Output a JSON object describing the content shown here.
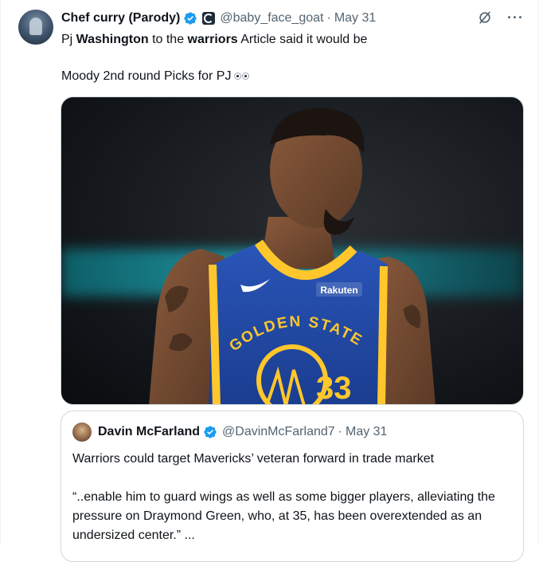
{
  "tweet": {
    "author_name": "Chef curry (Parody)",
    "handle": "@baby_face_goat",
    "separator": "·",
    "date": "May 31",
    "line1": {
      "p1": "Pj ",
      "b1": "Washington",
      "p2": " to the ",
      "b2": "warriors",
      "p3": " Article said it would be"
    },
    "line2": "Moody 2nd round Picks for PJ",
    "more_glyph": "···"
  },
  "photo": {
    "jersey_city": "GOLDEN STATE",
    "jersey_number": "33",
    "sponsor": "Rakuten"
  },
  "quote": {
    "author_name": "Davin McFarland",
    "handle": "@DavinMcFarland7",
    "separator": "·",
    "date": "May 31",
    "title": "Warriors could target Mavericks’ veteran forward in trade market",
    "excerpt": "“..enable him to guard wings as well as some bigger players, alleviating the pressure on Draymond Green, who, at 35, has been overextended as an undersized center.” ..."
  },
  "colors": {
    "verified": "#1d9bf0",
    "text": "#0f1419",
    "secondary": "#536471",
    "warriors_blue": "#1d428a",
    "warriors_gold": "#ffc72c"
  }
}
